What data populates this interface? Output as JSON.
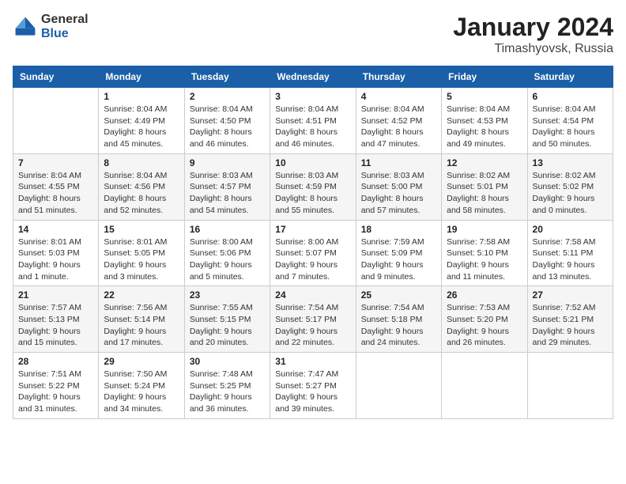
{
  "header": {
    "logo_general": "General",
    "logo_blue": "Blue",
    "title": "January 2024",
    "location": "Timashyovsk, Russia"
  },
  "columns": [
    "Sunday",
    "Monday",
    "Tuesday",
    "Wednesday",
    "Thursday",
    "Friday",
    "Saturday"
  ],
  "weeks": [
    [
      {
        "day": "",
        "info": ""
      },
      {
        "day": "1",
        "info": "Sunrise: 8:04 AM\nSunset: 4:49 PM\nDaylight: 8 hours\nand 45 minutes."
      },
      {
        "day": "2",
        "info": "Sunrise: 8:04 AM\nSunset: 4:50 PM\nDaylight: 8 hours\nand 46 minutes."
      },
      {
        "day": "3",
        "info": "Sunrise: 8:04 AM\nSunset: 4:51 PM\nDaylight: 8 hours\nand 46 minutes."
      },
      {
        "day": "4",
        "info": "Sunrise: 8:04 AM\nSunset: 4:52 PM\nDaylight: 8 hours\nand 47 minutes."
      },
      {
        "day": "5",
        "info": "Sunrise: 8:04 AM\nSunset: 4:53 PM\nDaylight: 8 hours\nand 49 minutes."
      },
      {
        "day": "6",
        "info": "Sunrise: 8:04 AM\nSunset: 4:54 PM\nDaylight: 8 hours\nand 50 minutes."
      }
    ],
    [
      {
        "day": "7",
        "info": "Sunrise: 8:04 AM\nSunset: 4:55 PM\nDaylight: 8 hours\nand 51 minutes."
      },
      {
        "day": "8",
        "info": "Sunrise: 8:04 AM\nSunset: 4:56 PM\nDaylight: 8 hours\nand 52 minutes."
      },
      {
        "day": "9",
        "info": "Sunrise: 8:03 AM\nSunset: 4:57 PM\nDaylight: 8 hours\nand 54 minutes."
      },
      {
        "day": "10",
        "info": "Sunrise: 8:03 AM\nSunset: 4:59 PM\nDaylight: 8 hours\nand 55 minutes."
      },
      {
        "day": "11",
        "info": "Sunrise: 8:03 AM\nSunset: 5:00 PM\nDaylight: 8 hours\nand 57 minutes."
      },
      {
        "day": "12",
        "info": "Sunrise: 8:02 AM\nSunset: 5:01 PM\nDaylight: 8 hours\nand 58 minutes."
      },
      {
        "day": "13",
        "info": "Sunrise: 8:02 AM\nSunset: 5:02 PM\nDaylight: 9 hours\nand 0 minutes."
      }
    ],
    [
      {
        "day": "14",
        "info": "Sunrise: 8:01 AM\nSunset: 5:03 PM\nDaylight: 9 hours\nand 1 minute."
      },
      {
        "day": "15",
        "info": "Sunrise: 8:01 AM\nSunset: 5:05 PM\nDaylight: 9 hours\nand 3 minutes."
      },
      {
        "day": "16",
        "info": "Sunrise: 8:00 AM\nSunset: 5:06 PM\nDaylight: 9 hours\nand 5 minutes."
      },
      {
        "day": "17",
        "info": "Sunrise: 8:00 AM\nSunset: 5:07 PM\nDaylight: 9 hours\nand 7 minutes."
      },
      {
        "day": "18",
        "info": "Sunrise: 7:59 AM\nSunset: 5:09 PM\nDaylight: 9 hours\nand 9 minutes."
      },
      {
        "day": "19",
        "info": "Sunrise: 7:58 AM\nSunset: 5:10 PM\nDaylight: 9 hours\nand 11 minutes."
      },
      {
        "day": "20",
        "info": "Sunrise: 7:58 AM\nSunset: 5:11 PM\nDaylight: 9 hours\nand 13 minutes."
      }
    ],
    [
      {
        "day": "21",
        "info": "Sunrise: 7:57 AM\nSunset: 5:13 PM\nDaylight: 9 hours\nand 15 minutes."
      },
      {
        "day": "22",
        "info": "Sunrise: 7:56 AM\nSunset: 5:14 PM\nDaylight: 9 hours\nand 17 minutes."
      },
      {
        "day": "23",
        "info": "Sunrise: 7:55 AM\nSunset: 5:15 PM\nDaylight: 9 hours\nand 20 minutes."
      },
      {
        "day": "24",
        "info": "Sunrise: 7:54 AM\nSunset: 5:17 PM\nDaylight: 9 hours\nand 22 minutes."
      },
      {
        "day": "25",
        "info": "Sunrise: 7:54 AM\nSunset: 5:18 PM\nDaylight: 9 hours\nand 24 minutes."
      },
      {
        "day": "26",
        "info": "Sunrise: 7:53 AM\nSunset: 5:20 PM\nDaylight: 9 hours\nand 26 minutes."
      },
      {
        "day": "27",
        "info": "Sunrise: 7:52 AM\nSunset: 5:21 PM\nDaylight: 9 hours\nand 29 minutes."
      }
    ],
    [
      {
        "day": "28",
        "info": "Sunrise: 7:51 AM\nSunset: 5:22 PM\nDaylight: 9 hours\nand 31 minutes."
      },
      {
        "day": "29",
        "info": "Sunrise: 7:50 AM\nSunset: 5:24 PM\nDaylight: 9 hours\nand 34 minutes."
      },
      {
        "day": "30",
        "info": "Sunrise: 7:48 AM\nSunset: 5:25 PM\nDaylight: 9 hours\nand 36 minutes."
      },
      {
        "day": "31",
        "info": "Sunrise: 7:47 AM\nSunset: 5:27 PM\nDaylight: 9 hours\nand 39 minutes."
      },
      {
        "day": "",
        "info": ""
      },
      {
        "day": "",
        "info": ""
      },
      {
        "day": "",
        "info": ""
      }
    ]
  ]
}
